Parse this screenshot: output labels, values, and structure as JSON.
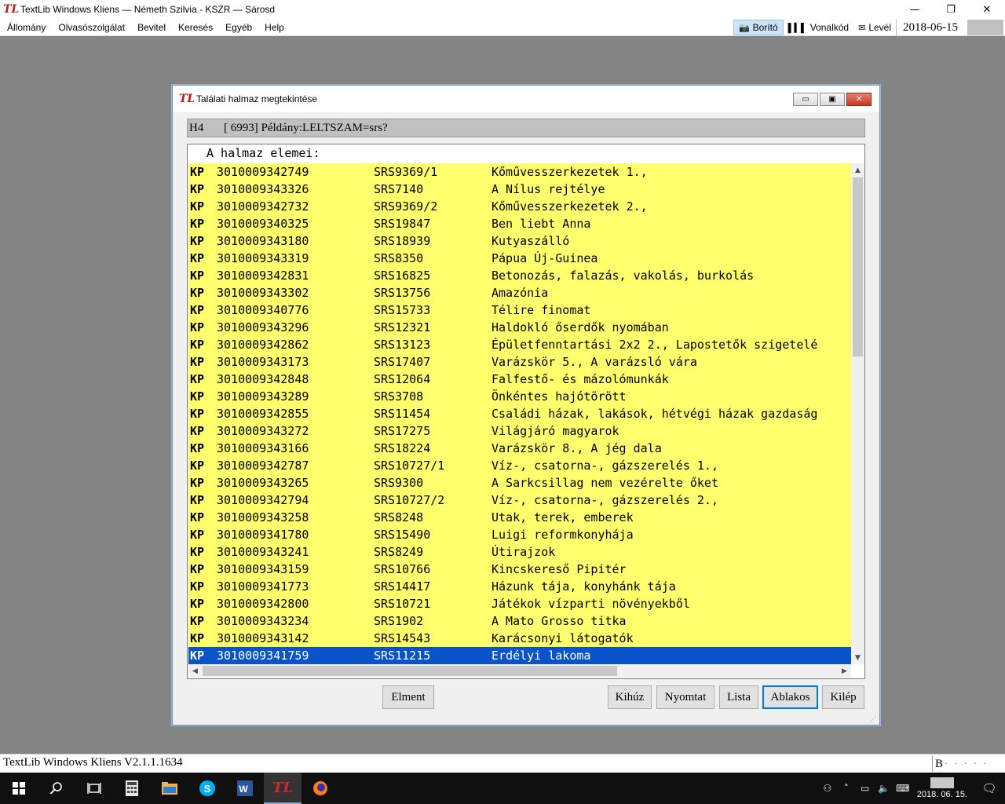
{
  "app": {
    "logo": "TL",
    "title": "TextLib Windows Kliens — Németh Szilvia - KSZR — Sárosd"
  },
  "window_controls": {
    "minimize": "—",
    "restore": "❐",
    "close": "✕"
  },
  "menu": [
    "Állomány",
    "Olvasószolgálat",
    "Bevitel",
    "Keresés",
    "Egyéb",
    "Help"
  ],
  "toolbar": {
    "borito": "Borító",
    "vonalkod": "Vonalkód",
    "level": "Levél",
    "date": "2018-06-15"
  },
  "dialog": {
    "logo": "TL",
    "title": "Találati halmaz megtekintése",
    "query_set": "H4",
    "query_text": "[ 6993] Példány:LELTSZAM=srs?",
    "list_heading": "A halmaz elemei:",
    "buttons": {
      "elment": "Elment",
      "kihuz": "Kihúz",
      "nyomtat": "Nyomtat",
      "lista": "Lista",
      "ablakos": "Ablakos",
      "kilep": "Kilép"
    }
  },
  "rows": [
    {
      "type": "KP",
      "barcode": "3010009342749",
      "signature": "SRS9369/1",
      "title": "Kőművesszerkezetek 1.,"
    },
    {
      "type": "KP",
      "barcode": "3010009343326",
      "signature": "SRS7140",
      "title": "A Nílus rejtélye"
    },
    {
      "type": "KP",
      "barcode": "3010009342732",
      "signature": "SRS9369/2",
      "title": "Kőművesszerkezetek 2.,"
    },
    {
      "type": "KP",
      "barcode": "3010009340325",
      "signature": "SRS19847",
      "title": "Ben liebt Anna"
    },
    {
      "type": "KP",
      "barcode": "3010009343180",
      "signature": "SRS18939",
      "title": "Kutyaszálló"
    },
    {
      "type": "KP",
      "barcode": "3010009343319",
      "signature": "SRS8350",
      "title": "Pápua Új-Guinea"
    },
    {
      "type": "KP",
      "barcode": "3010009342831",
      "signature": "SRS16825",
      "title": "Betonozás, falazás, vakolás, burkolás"
    },
    {
      "type": "KP",
      "barcode": "3010009343302",
      "signature": "SRS13756",
      "title": "Amazónia"
    },
    {
      "type": "KP",
      "barcode": "3010009340776",
      "signature": "SRS15733",
      "title": "Télire finomat"
    },
    {
      "type": "KP",
      "barcode": "3010009343296",
      "signature": "SRS12321",
      "title": "Haldokló őserdők nyomában"
    },
    {
      "type": "KP",
      "barcode": "3010009342862",
      "signature": "SRS13123",
      "title": "Épületfenntartási 2x2 2., Lapostetők szigetelé"
    },
    {
      "type": "KP",
      "barcode": "3010009343173",
      "signature": "SRS17407",
      "title": "Varázskör 5., A varázsló vára"
    },
    {
      "type": "KP",
      "barcode": "3010009342848",
      "signature": "SRS12064",
      "title": "Falfestő- és mázolómunkák"
    },
    {
      "type": "KP",
      "barcode": "3010009343289",
      "signature": "SRS3708",
      "title": "Önkéntes hajótörött"
    },
    {
      "type": "KP",
      "barcode": "3010009342855",
      "signature": "SRS11454",
      "title": "Családi házak, lakások, hétvégi házak gazdaság"
    },
    {
      "type": "KP",
      "barcode": "3010009343272",
      "signature": "SRS17275",
      "title": "Világjáró magyarok"
    },
    {
      "type": "KP",
      "barcode": "3010009343166",
      "signature": "SRS18224",
      "title": "Varázskör 8., A jég dala"
    },
    {
      "type": "KP",
      "barcode": "3010009342787",
      "signature": "SRS10727/1",
      "title": "Víz-, csatorna-, gázszerelés 1.,"
    },
    {
      "type": "KP",
      "barcode": "3010009343265",
      "signature": "SRS9300",
      "title": "A Sarkcsillag nem vezérelte őket"
    },
    {
      "type": "KP",
      "barcode": "3010009342794",
      "signature": "SRS10727/2",
      "title": "Víz-, csatorna-, gázszerelés 2.,"
    },
    {
      "type": "KP",
      "barcode": "3010009343258",
      "signature": "SRS8248",
      "title": "Utak, terek, emberek"
    },
    {
      "type": "KP",
      "barcode": "3010009341780",
      "signature": "SRS15490",
      "title": "Luigi reformkonyhája"
    },
    {
      "type": "KP",
      "barcode": "3010009343241",
      "signature": "SRS8249",
      "title": "Útirajzok"
    },
    {
      "type": "KP",
      "barcode": "3010009343159",
      "signature": "SRS10766",
      "title": "Kincskereső Pipitér"
    },
    {
      "type": "KP",
      "barcode": "3010009341773",
      "signature": "SRS14417",
      "title": "Házunk tája, konyhánk tája"
    },
    {
      "type": "KP",
      "barcode": "3010009342800",
      "signature": "SRS10721",
      "title": "Játékok vízparti növényekből"
    },
    {
      "type": "KP",
      "barcode": "3010009343234",
      "signature": "SRS1902",
      "title": "A Mato Grosso titka"
    },
    {
      "type": "KP",
      "barcode": "3010009343142",
      "signature": "SRS14543",
      "title": "Karácsonyi látogatók"
    },
    {
      "type": "KP",
      "barcode": "3010009341759",
      "signature": "SRS11215",
      "title": "Erdélyi lakoma",
      "selected": true
    }
  ],
  "status": {
    "text": "TextLib Windows Kliens V2.1.1.1634",
    "mode": "B",
    "dots": "· · · · ·"
  },
  "taskbar": {
    "apps": [
      "windows-start",
      "search",
      "task-view",
      "calculator",
      "file-explorer",
      "skype",
      "word",
      "textlib",
      "firefox"
    ],
    "clock_date": "2018. 06. 15."
  },
  "colors": {
    "list_background": "#ffff6e",
    "selection": "#0a54c8",
    "desktop": "#848484"
  }
}
